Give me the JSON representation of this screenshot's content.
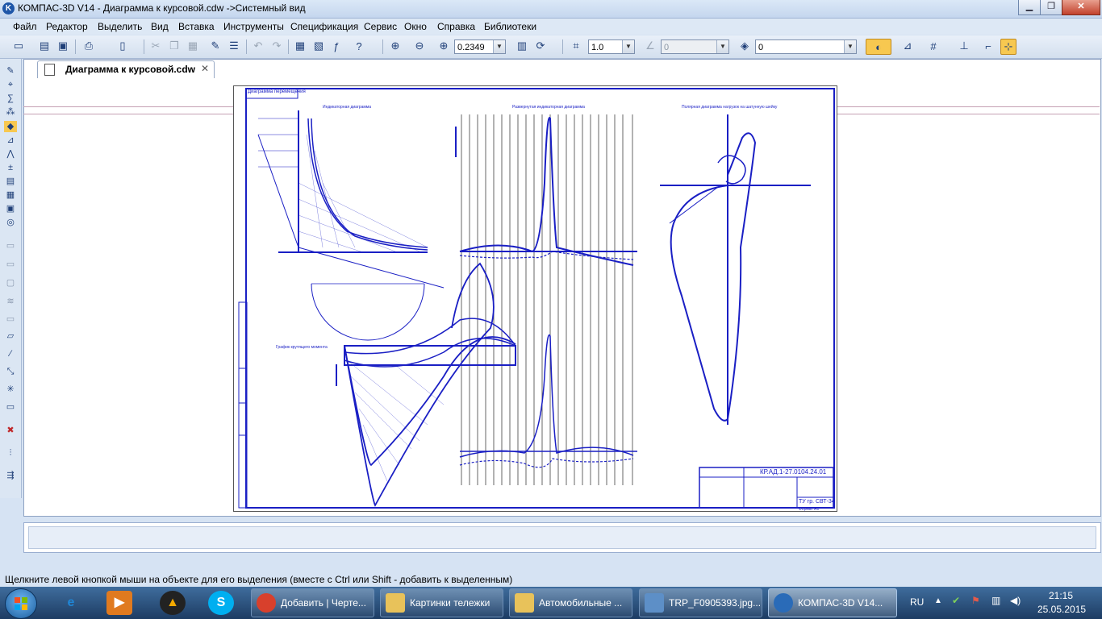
{
  "window": {
    "title": "КОМПАС-3D V14 - Диаграмма к курсовой.cdw ->Системный вид",
    "app_icon": "K",
    "controls": {
      "minimize": "▁",
      "maximize": "❐",
      "close": "✕"
    }
  },
  "menu": [
    "Файл",
    "Редактор",
    "Выделить",
    "Вид",
    "Вставка",
    "Инструменты",
    "Спецификация",
    "Сервис",
    "Окно",
    "Справка",
    "Библиотеки"
  ],
  "toolbar": {
    "zoom_value": "0.2349",
    "step_value": "1.0",
    "angle_value": "0",
    "layer_value": "0"
  },
  "document_tab": {
    "label": "Диаграмма к курсовой.cdw",
    "close": "✕"
  },
  "drawing": {
    "stamp_code": "КР.АД.1-27.0104.24.01",
    "stamp_group": "ТУ гр. СВТ-34",
    "sheet_format": "Формат А1",
    "title_left_block": "Диаграмма перемещения",
    "section1": "Индикаторная диаграмма",
    "section2": "Развернутая индикаторная диаграмма",
    "section3": "Полярная диаграмма нагрузок на шатунную шейку",
    "section4": "График крутящего момента"
  },
  "status_text": "Щелкните левой кнопкой мыши на объекте для его выделения (вместе с Ctrl или Shift - добавить к выделенным)",
  "taskbar": {
    "items": [
      {
        "label": "Добавить | Черте...",
        "color": "#d8402c"
      },
      {
        "label": "Картинки тележки",
        "color": "#e8c25a"
      },
      {
        "label": "Автомобильные ...",
        "color": "#e8c25a"
      },
      {
        "label": "TRP_F0905393.jpg...",
        "color": "#5d8fc7"
      },
      {
        "label": "КОМПАС-3D V14...",
        "color": "#2a6bb8"
      }
    ],
    "lang": "RU",
    "time": "21:15",
    "date": "25.05.2015"
  },
  "colors": {
    "drawing_blue": "#1a1fc4",
    "title_bg": "#dbe8f7",
    "taskbar": "#2a4f7c"
  }
}
